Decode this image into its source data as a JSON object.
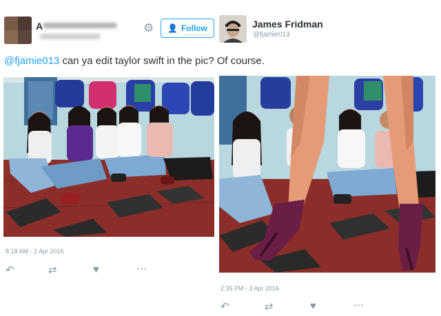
{
  "left_tweet": {
    "author_name": "A",
    "follow_label": "Follow",
    "timestamp": "8:18 AM - 2 Apr 2016",
    "icons": [
      "reply-icon",
      "retweet-icon",
      "like-icon",
      "more-icon"
    ]
  },
  "right_tweet": {
    "author_name": "James Fridman",
    "author_handle": "@fjamie013",
    "timestamp": "2:35 PM - 3 Apr 2016",
    "icons": [
      "reply-icon",
      "retweet-icon",
      "like-icon",
      "more-icon"
    ]
  },
  "tweet_text": {
    "mention": "@fjamie013",
    "question": " can ya edit taylor swift in the pic? ",
    "answer": "Of course."
  },
  "colors": {
    "twitter_blue": "#1da1f2",
    "muted_gray": "#8899a6",
    "text_dark": "#292f33"
  }
}
